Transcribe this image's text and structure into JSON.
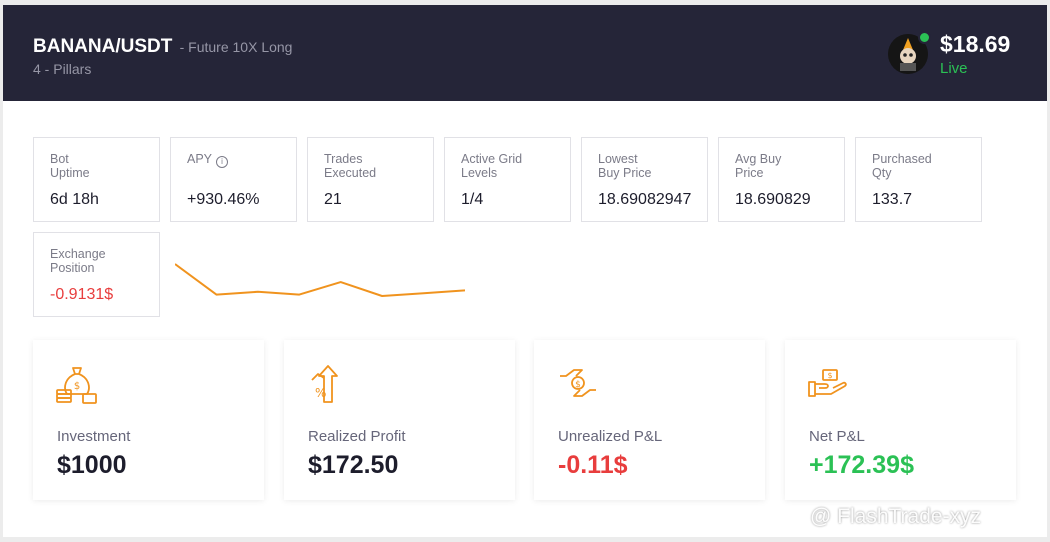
{
  "header": {
    "pair": "BANANA/USDT",
    "subtitle": "- Future 10X Long",
    "strategy": "4 - Pillars",
    "price": "$18.69",
    "status": "Live"
  },
  "stats": [
    {
      "label": "Bot Uptime",
      "value": "6d 18h"
    },
    {
      "label": "APY",
      "value": "+930.46%",
      "icon": "info-icon"
    },
    {
      "label": "Trades Executed",
      "value": "21"
    },
    {
      "label": "Active Grid Levels",
      "value": "1/4"
    },
    {
      "label": "Lowest Buy Price",
      "value": "18.69082947"
    },
    {
      "label": "Avg Buy Price",
      "value": "18.690829"
    },
    {
      "label": "Purchased Qty",
      "value": "133.7"
    },
    {
      "label": "Exchange Position",
      "value": "-0.9131$"
    }
  ],
  "sparkline": {
    "values": [
      18.88,
      18.66,
      18.68,
      18.66,
      18.75,
      18.65,
      18.67,
      18.69
    ]
  },
  "cards": [
    {
      "label": "Investment",
      "value": "$1000",
      "icon": "money-bag-icon"
    },
    {
      "label": "Realized Profit",
      "value": "$172.50",
      "icon": "profit-growth-icon"
    },
    {
      "label": "Unrealized P&L",
      "value": "-0.11$",
      "icon": "handshake-coin-icon"
    },
    {
      "label": "Net P&L",
      "value": "+172.39$",
      "icon": "hand-cash-icon"
    }
  ],
  "watermark": "@ FlashTrade-xyz",
  "colors": {
    "header_bg": "#252538",
    "accent": "#f0931e",
    "positive": "#2bc155",
    "negative": "#e83d3d"
  }
}
